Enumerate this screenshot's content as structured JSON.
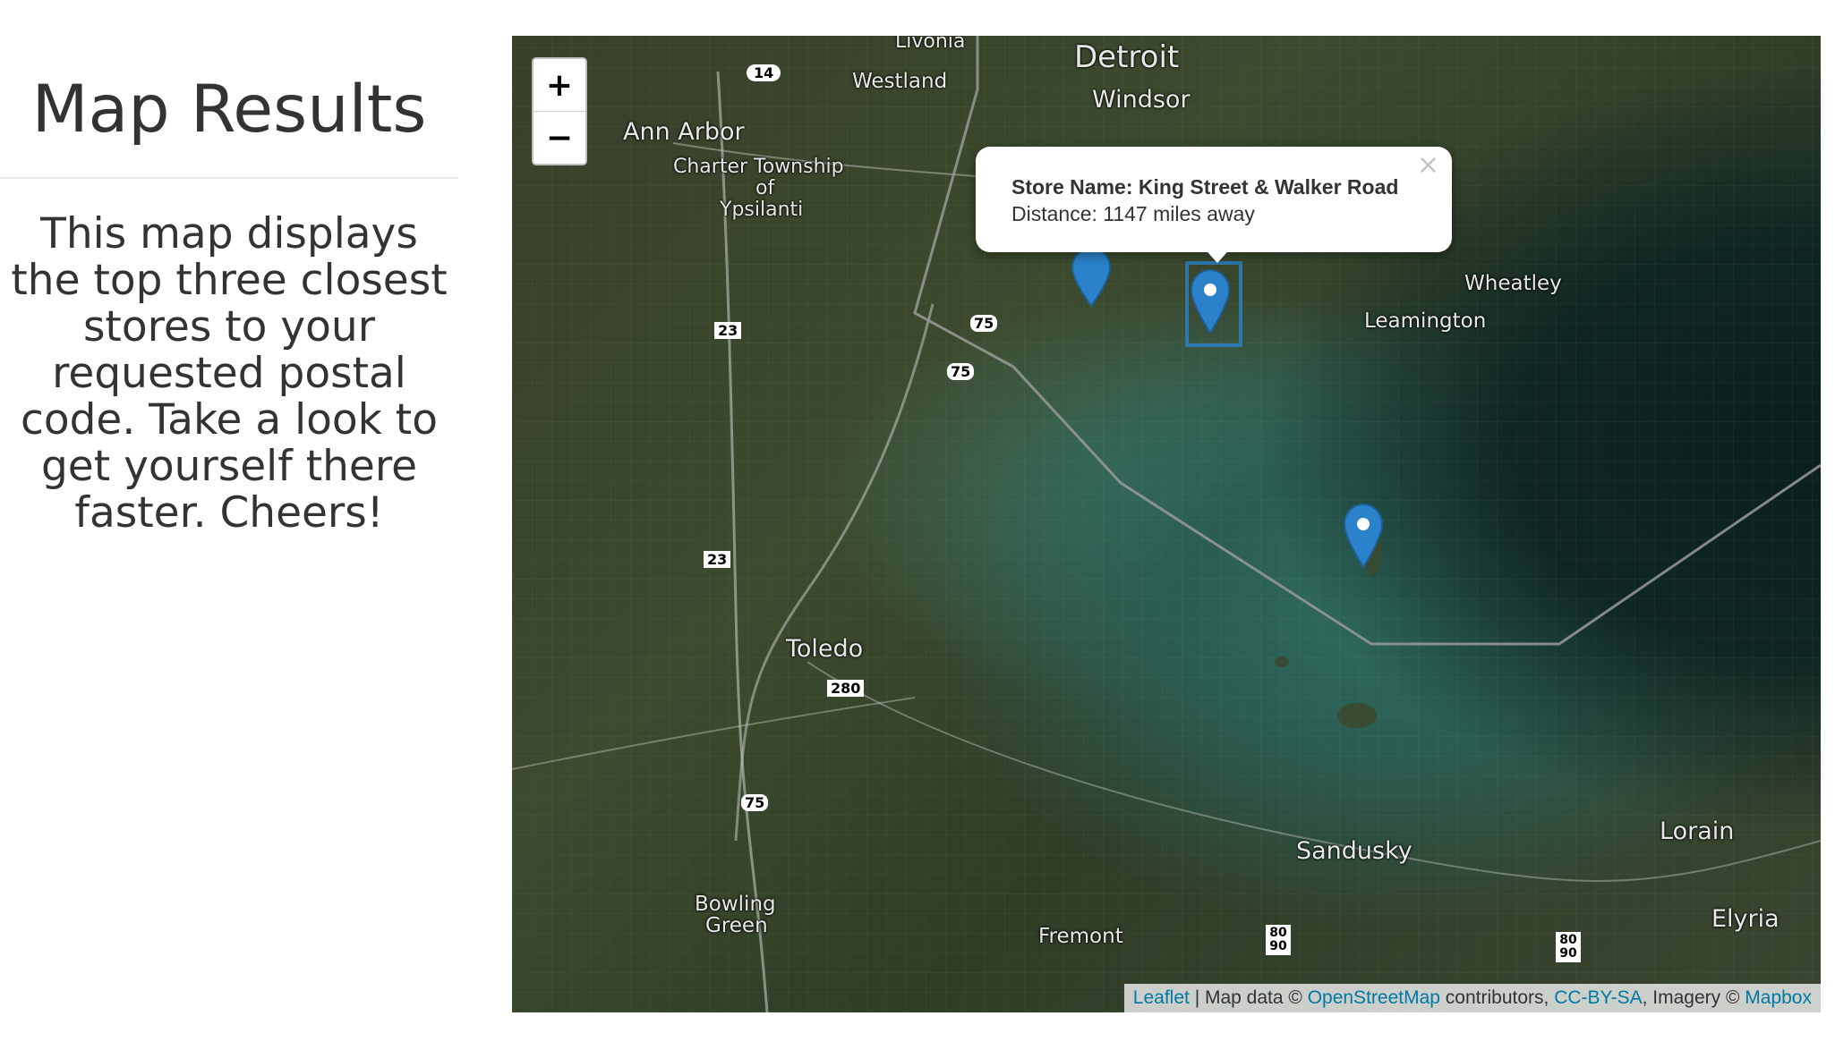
{
  "sidebar": {
    "title": "Map Results",
    "description": "This map displays the top three closest stores to your requested postal code. Take a look to get yourself there faster. Cheers!"
  },
  "map": {
    "zoom_in_label": "+",
    "zoom_out_label": "−",
    "labels": {
      "livonia": "Livonia",
      "westland": "Westland",
      "detroit": "Detroit",
      "windsor": "Windsor",
      "ann_arbor": "Ann Arbor",
      "charter_township": "Charter Township",
      "of": "of",
      "ypsilanti": "Ypsilanti",
      "wheatley": "Wheatley",
      "leamington": "Leamington",
      "toledo": "Toledo",
      "sandusky": "Sandusky",
      "lorain": "Lorain",
      "elyria": "Elyria",
      "bowling": "Bowling",
      "green": "Green",
      "fremont": "Fremont",
      "shield_14": "14",
      "shield_23a": "23",
      "shield_23b": "23",
      "shield_75a": "75",
      "shield_75b": "75",
      "shield_75c": "75",
      "shield_280": "280",
      "shield_80_90a": "80 90",
      "shield_80_90b": "80 90"
    },
    "popup": {
      "close_label": "×",
      "store_name": "Store Name: King Street & Walker Road",
      "distance": "Distance: 1147 miles away"
    },
    "markers": [
      {
        "name": "marker-1",
        "color": "#2b82cb"
      },
      {
        "name": "marker-2",
        "color": "#2b82cb"
      },
      {
        "name": "marker-3",
        "color": "#2b82cb"
      }
    ],
    "attribution": {
      "leaflet": "Leaflet",
      "map_data": " | Map data © ",
      "osm": "OpenStreetMap",
      "contributors": " contributors, ",
      "license": "CC-BY-SA",
      "imagery": ", Imagery © ",
      "mapbox": "Mapbox"
    }
  },
  "colors": {
    "marker": "#2b82cb",
    "link": "#0078a8",
    "text": "#333333"
  }
}
